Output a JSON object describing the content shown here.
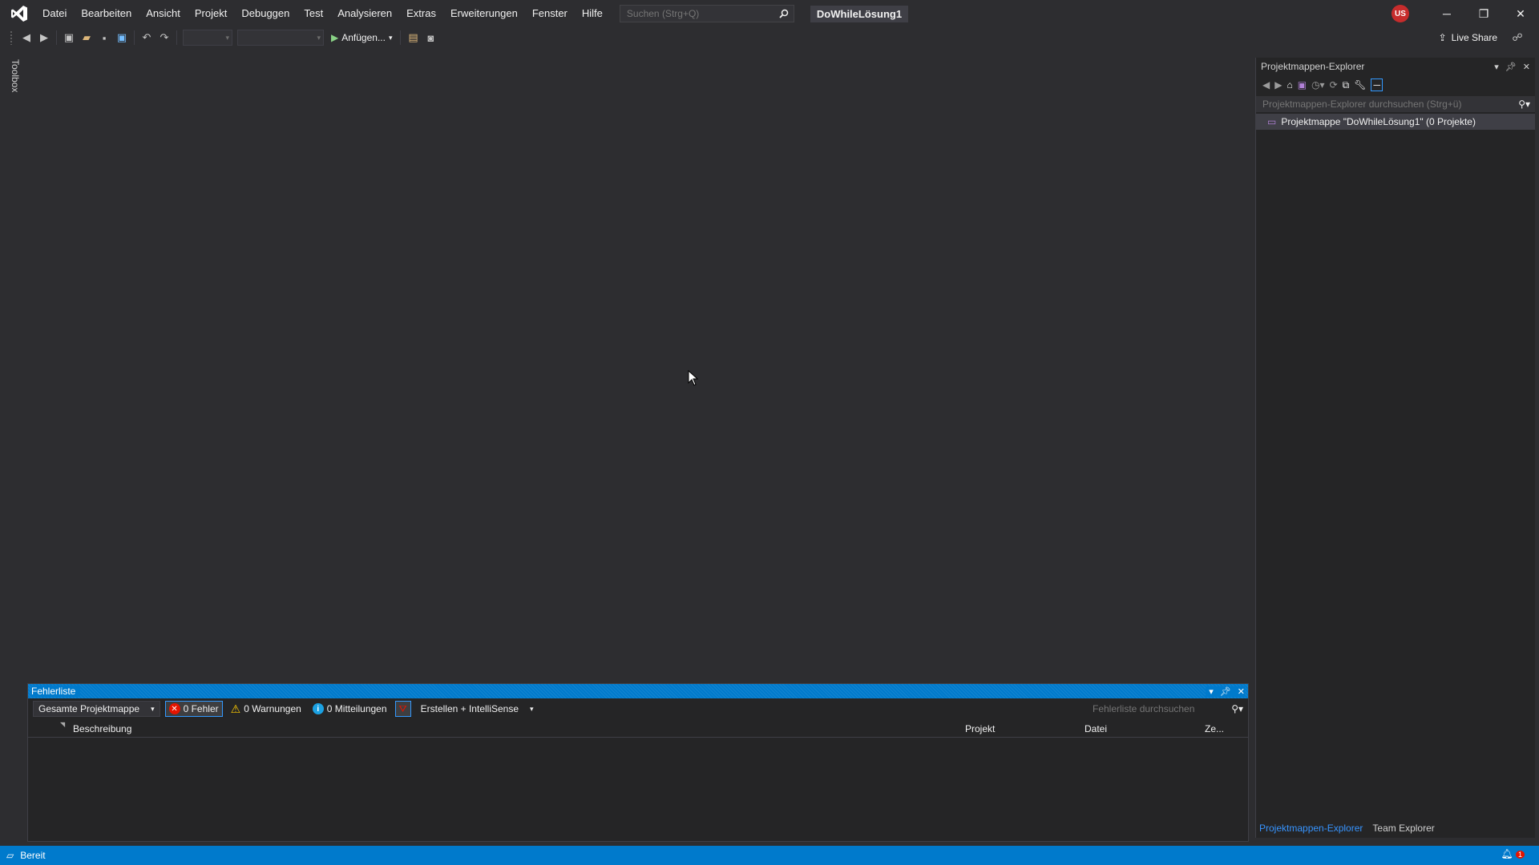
{
  "menu": {
    "items": [
      "Datei",
      "Bearbeiten",
      "Ansicht",
      "Projekt",
      "Debuggen",
      "Test",
      "Analysieren",
      "Extras",
      "Erweiterungen",
      "Fenster",
      "Hilfe"
    ],
    "search_placeholder": "Suchen (Strg+Q)"
  },
  "title": {
    "solution_name": "DoWhileLösung1",
    "user_initials": "US"
  },
  "toolbar": {
    "attach_label": "Anfügen...",
    "live_share_label": "Live Share"
  },
  "toolbox": {
    "label": "Toolbox"
  },
  "solution_explorer": {
    "title": "Projektmappen-Explorer",
    "search_placeholder": "Projektmappen-Explorer durchsuchen (Strg+ü)",
    "solution_node": "Projektmappe \"DoWhileLösung1\" (0 Projekte)",
    "tabs": [
      "Projektmappen-Explorer",
      "Team Explorer"
    ]
  },
  "error_list": {
    "title": "Fehlerliste",
    "scope": "Gesamte Projektmappe",
    "errors": "0 Fehler",
    "warnings": "0 Warnungen",
    "messages": "0 Mitteilungen",
    "source": "Erstellen + IntelliSense",
    "search_placeholder": "Fehlerliste durchsuchen",
    "columns": [
      "Beschreibung",
      "Projekt",
      "Datei",
      "Ze..."
    ]
  },
  "status": {
    "text": "Bereit",
    "notification_count": "1"
  },
  "colors": {
    "accent": "#007acc",
    "background": "#2d2d30",
    "panel": "#252526",
    "avatar": "#c72c2c"
  }
}
